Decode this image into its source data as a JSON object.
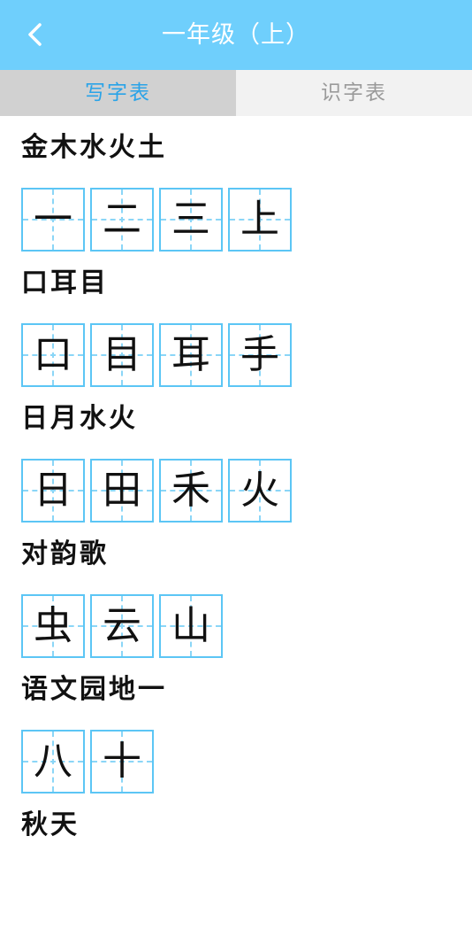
{
  "header": {
    "title": "一年级（上）",
    "back_icon": "chevron-left-icon",
    "background": "#6fcffc"
  },
  "tabs": [
    {
      "label": "写字表",
      "active": true
    },
    {
      "label": "识字表",
      "active": false
    }
  ],
  "lessons": [
    {
      "title": "金木水火土",
      "chars": [
        "一",
        "二",
        "三",
        "上"
      ]
    },
    {
      "title": "口耳目",
      "chars": [
        "口",
        "目",
        "耳",
        "手"
      ]
    },
    {
      "title": "日月水火",
      "chars": [
        "日",
        "田",
        "禾",
        "火"
      ]
    },
    {
      "title": "对韵歌",
      "chars": [
        "虫",
        "云",
        "山"
      ]
    },
    {
      "title": "语文园地一",
      "chars": [
        "八",
        "十"
      ]
    },
    {
      "title": "秋天",
      "chars": []
    }
  ],
  "colors": {
    "accent": "#29a3e8",
    "grid_border": "#5cc6f5",
    "tab_active_bg": "#d1d1d1",
    "tab_inactive_bg": "#f2f2f2"
  }
}
